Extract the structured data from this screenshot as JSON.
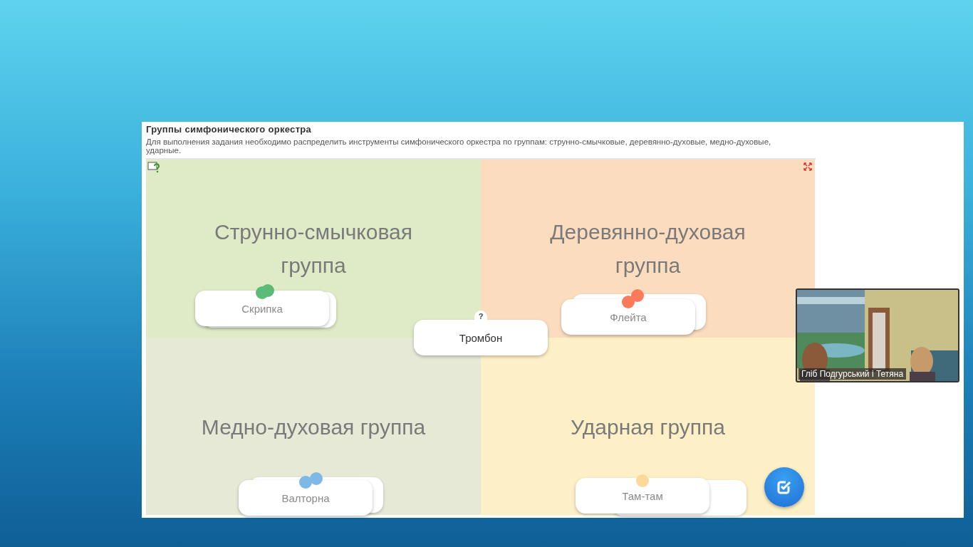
{
  "exercise": {
    "title": "Группы симфонического оркестра",
    "description": "Для выполнения задания необходимо распределить инструменты симфонического оркестра по группам: струнно-смычковые, деревянно-духовые, медно-духовые, ударные."
  },
  "groups": [
    {
      "title": "Струнно-смычковая группа",
      "color": "#dfeac7"
    },
    {
      "title": "Деревянно-духовая группа",
      "color": "#fcdcbf"
    },
    {
      "title": "Медно-духовая группа",
      "color": "#e5e9d6"
    },
    {
      "title": "Ударная группа",
      "color": "#fdefc6"
    }
  ],
  "cards": [
    {
      "label": "Скрипка",
      "kind": "placed",
      "stacked": true,
      "color": "#5dbb7a"
    },
    {
      "label": "Флейта",
      "kind": "placed",
      "stacked": true,
      "color": "#fb7a5b"
    },
    {
      "label": "Тромбон",
      "kind": "unplaced",
      "stacked": false,
      "badge": "?"
    },
    {
      "label": "Валторна",
      "kind": "placed",
      "stacked": true,
      "color": "#7db8e6"
    },
    {
      "label": "Там-там",
      "kind": "placed",
      "stacked": true,
      "color": "#fbd99a"
    }
  ],
  "video": {
    "caption": "Гліб Подгурський і Тетяна"
  }
}
